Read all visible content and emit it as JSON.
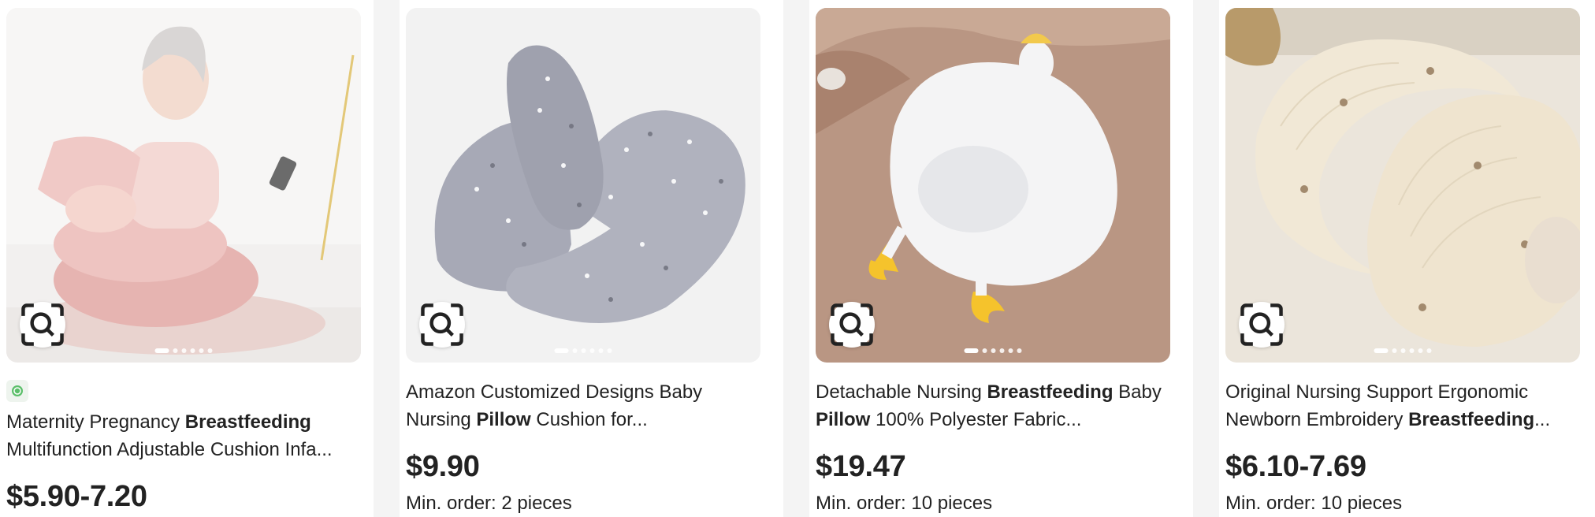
{
  "products": [
    {
      "title_parts": [
        "Maternity Pregnancy ",
        "Breastfeeding",
        " Multifunction Adjustable Cushion Infa..."
      ],
      "price": "$5.90-7.20",
      "min_order": "",
      "verified_icon": "verified-supplier-icon",
      "dots": 6
    },
    {
      "title_parts": [
        "Amazon Customized Designs Baby Nursing ",
        "Pillow",
        " Cushion for..."
      ],
      "price": "$9.90",
      "min_order": "Min. order: 2 pieces",
      "dots": 6
    },
    {
      "title_parts": [
        "Detachable Nursing ",
        "Breastfeeding",
        " Baby ",
        "Pillow",
        " 100% Polyester Fabric..."
      ],
      "price": "$19.47",
      "min_order": "Min. order: 10 pieces",
      "dots": 6
    },
    {
      "title_parts": [
        "Original Nursing Support Ergonomic Newborn Embroidery ",
        "Breastfeeding",
        "..."
      ],
      "price": "$6.10-7.69",
      "min_order": "Min. order: 10 pieces",
      "dots": 6
    }
  ],
  "icons": {
    "image_search": "image-search-icon"
  },
  "colors": {
    "text": "#222222",
    "background": "#f4f4f4",
    "card": "#ffffff"
  }
}
